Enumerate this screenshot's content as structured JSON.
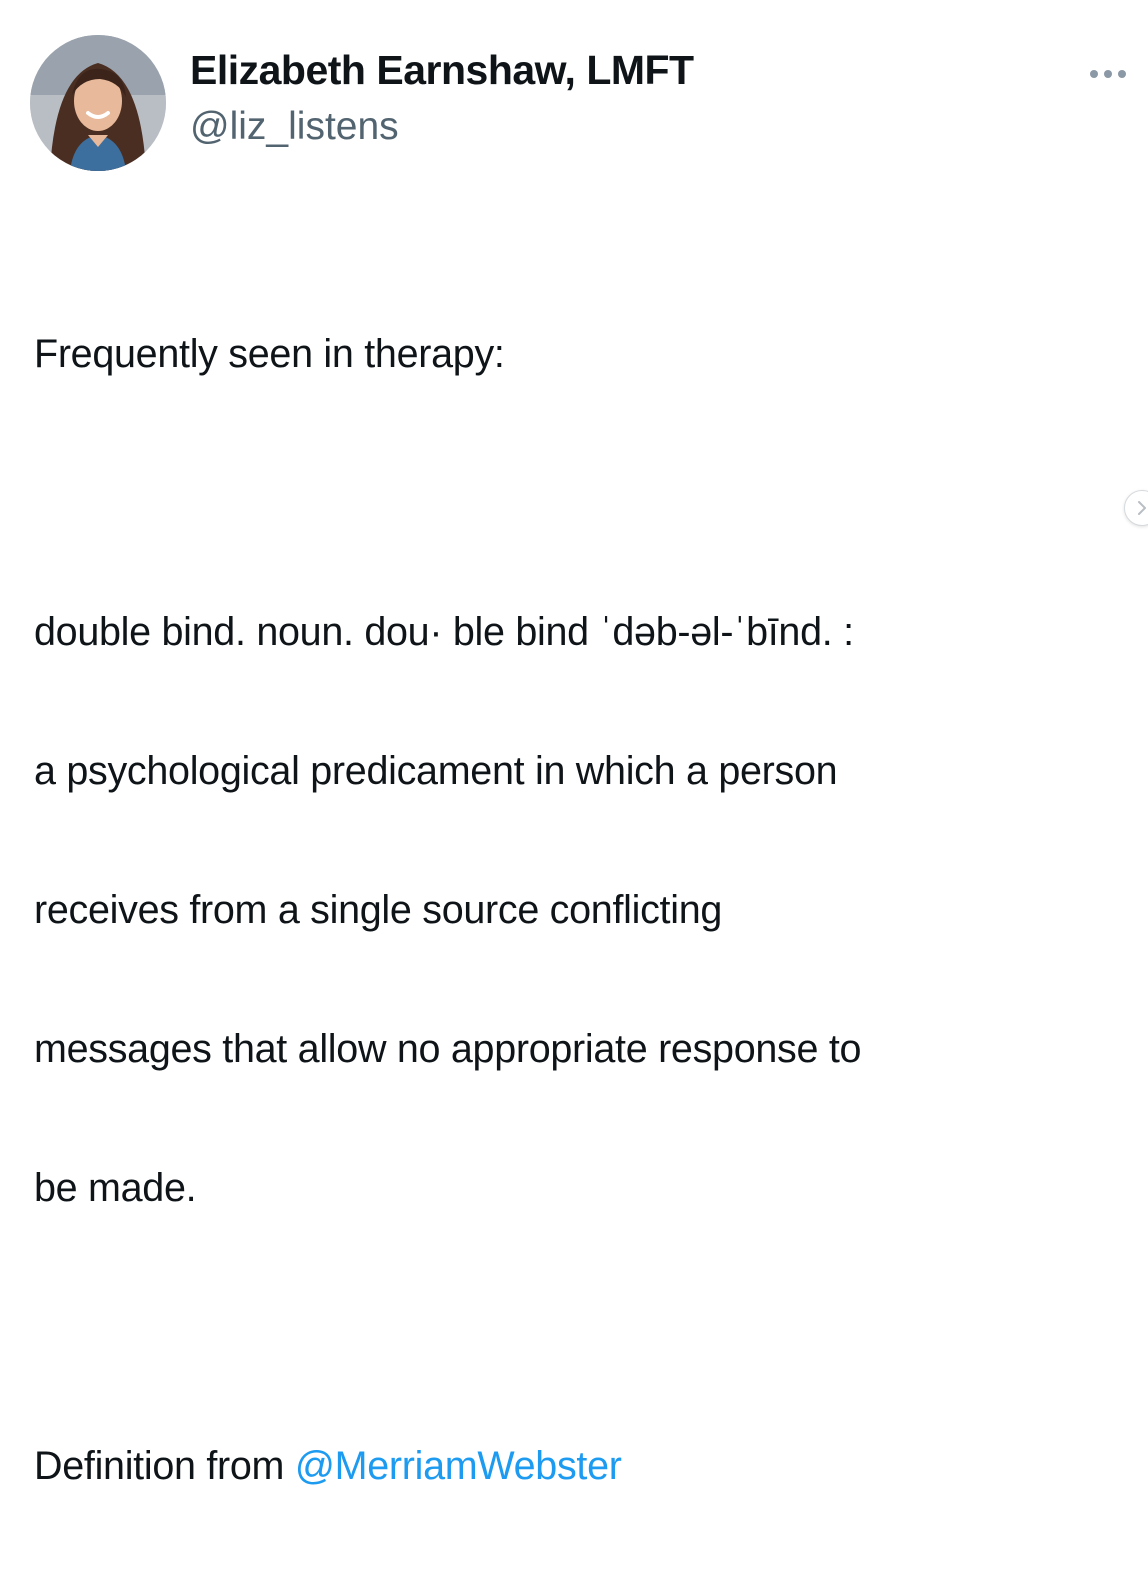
{
  "author": {
    "display_name": "Elizabeth Earnshaw, LMFT",
    "handle": "@liz_listens",
    "avatar_icon": "profile-photo"
  },
  "more_icon": "ellipsis-horizontal-icon",
  "tweet": {
    "line_intro": "Frequently seen in therapy:",
    "definition_line_1": "double bind. noun. dou· ble bind ˈdəb-əl-ˈbīnd. :",
    "definition_line_2": "a psychological predicament in which a person",
    "definition_line_3": "receives from a single source conflicting",
    "definition_line_4": "messages that allow no appropriate response to",
    "definition_line_5": "be made.",
    "source_prefix": "Definition from ",
    "source_mention": "@MerriamWebster"
  },
  "carousel": {
    "next_icon": "chevron-right-icon"
  },
  "colors": {
    "text": "#0f1419",
    "secondary_text": "#536471",
    "link": "#1d9bf0"
  }
}
